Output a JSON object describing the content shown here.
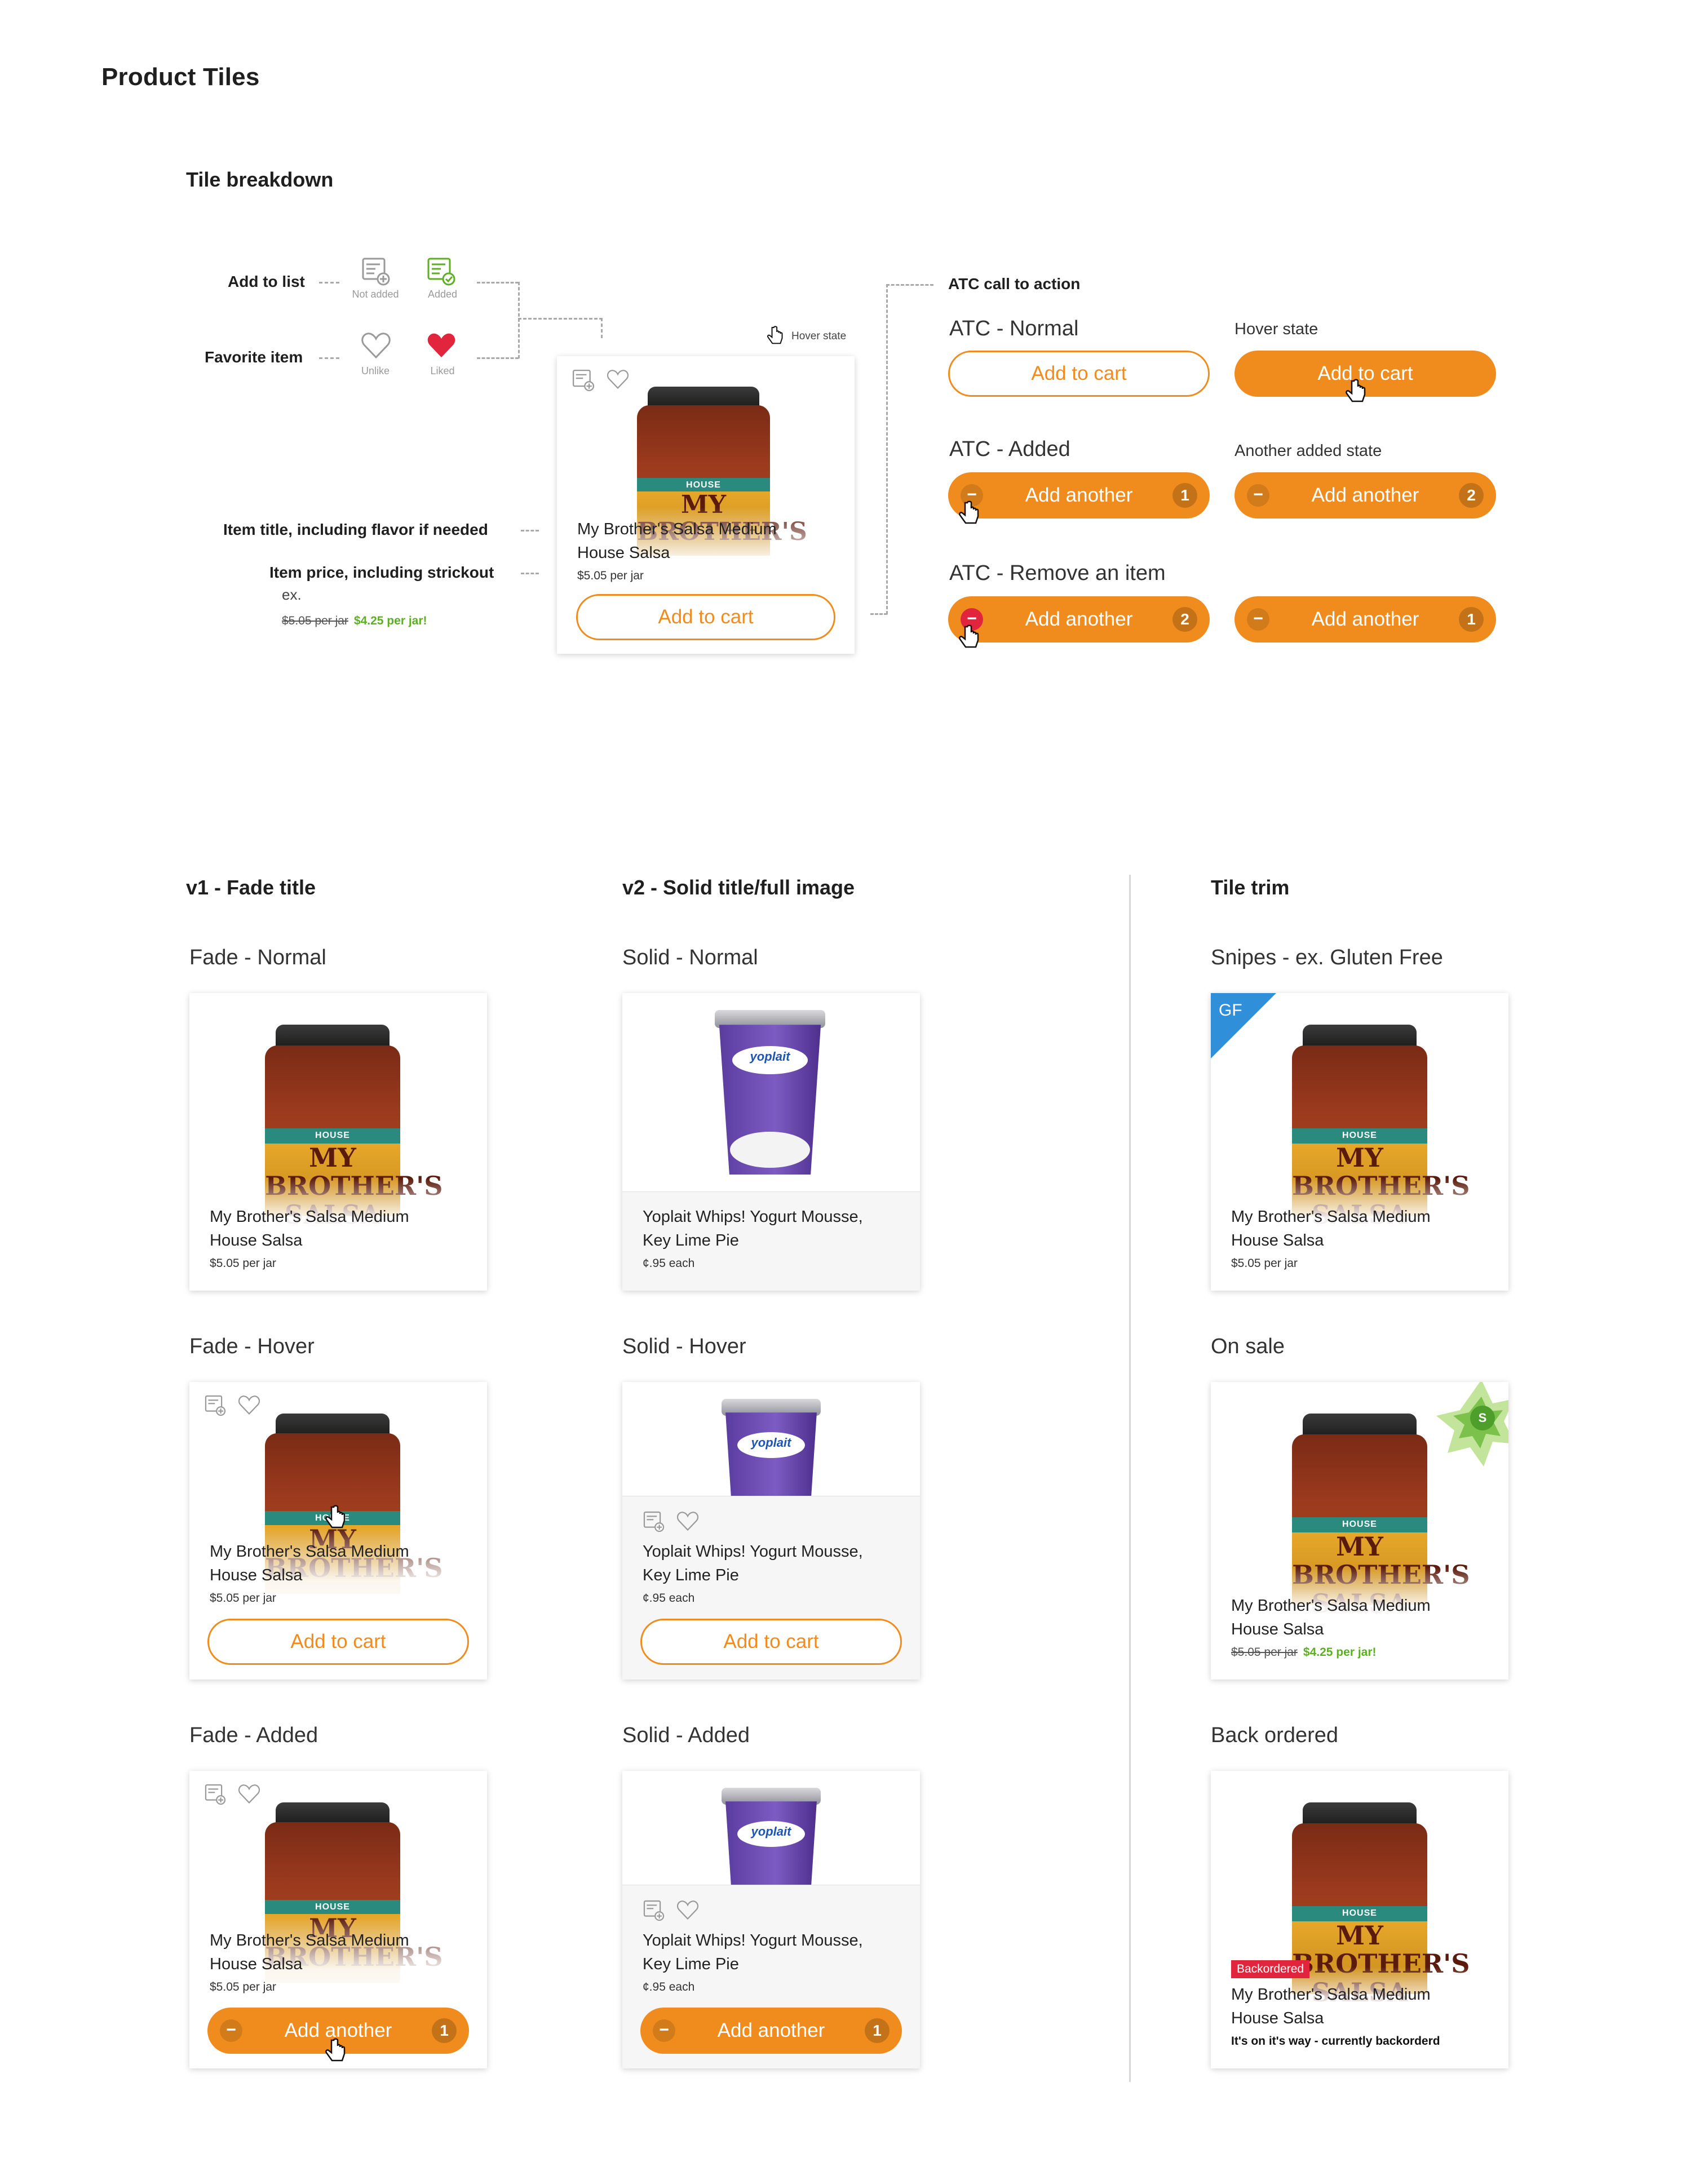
{
  "page": {
    "title": "Product Tiles"
  },
  "colors": {
    "accent": "#f08c1e",
    "sale": "#5cae23",
    "liked": "#e0253c",
    "backordered": "#e0253c",
    "gf": "#2f8fd8"
  },
  "breakdown": {
    "heading": "Tile breakdown",
    "add_to_list_label": "Add to list",
    "not_added": "Not added",
    "added": "Added",
    "favorite_label": "Favorite item",
    "unlike": "Unlike",
    "liked": "Liked",
    "hover_state": "Hover state",
    "item_title_label": "Item title, including flavor if needed",
    "item_price_label": "Item price, including strickout",
    "ex": "ex.",
    "ex_old_price": "$5.05 per jar",
    "ex_sale_price": "$4.25 per jar!",
    "atc_label": "ATC call to action",
    "tile": {
      "title": "My Brother's Salsa Medium House Salsa",
      "price": "$5.05 per jar",
      "button": "Add to cart"
    }
  },
  "atc": {
    "normal_label": "ATC - Normal",
    "normal_button": "Add to cart",
    "hover_label": "Hover state",
    "hover_button": "Add to cart",
    "added_label": "ATC - Added",
    "added_button": "Add another",
    "added_qty": "1",
    "another_label": "Another added state",
    "another_button": "Add another",
    "another_qty": "2",
    "remove_label": "ATC - Remove an item",
    "remove_button": "Add another",
    "remove_qty": "2",
    "removed_button": "Add another",
    "removed_qty": "1"
  },
  "columns": {
    "v1": "v1 - Fade title",
    "v2": "v2 - Solid title/full image",
    "trim": "Tile trim"
  },
  "v1": {
    "normal_label": "Fade - Normal",
    "hover_label": "Fade - Hover",
    "added_label": "Fade - Added",
    "title": "My Brother's Salsa Medium House Salsa",
    "price": "$5.05 per jar",
    "button": "Add to cart",
    "added_button": "Add another",
    "added_qty": "1"
  },
  "v2": {
    "normal_label": "Solid - Normal",
    "hover_label": "Solid - Hover",
    "added_label": "Solid - Added",
    "title": "Yoplait Whips! Yogurt Mousse, Key Lime Pie",
    "price": "¢.95 each",
    "button": "Add to cart",
    "added_button": "Add another",
    "added_qty": "1"
  },
  "trim": {
    "snipes_label": "Snipes - ex. Gluten Free",
    "gf": "GF",
    "sale_label": "On sale",
    "sale_badge": "S",
    "back_label": "Back ordered",
    "backordered_badge": "Backordered",
    "title": "My Brother's Salsa Medium House Salsa",
    "price": "$5.05 per jar",
    "old_price": "$5.05 per jar",
    "sale_price": "$4.25 per jar!",
    "back_note": "It's on it's way - currently backorderd"
  },
  "icons": [
    "list-add-icon",
    "list-added-icon",
    "heart-outline-icon",
    "heart-filled-icon",
    "hand-cursor-icon",
    "star-badge-icon"
  ]
}
